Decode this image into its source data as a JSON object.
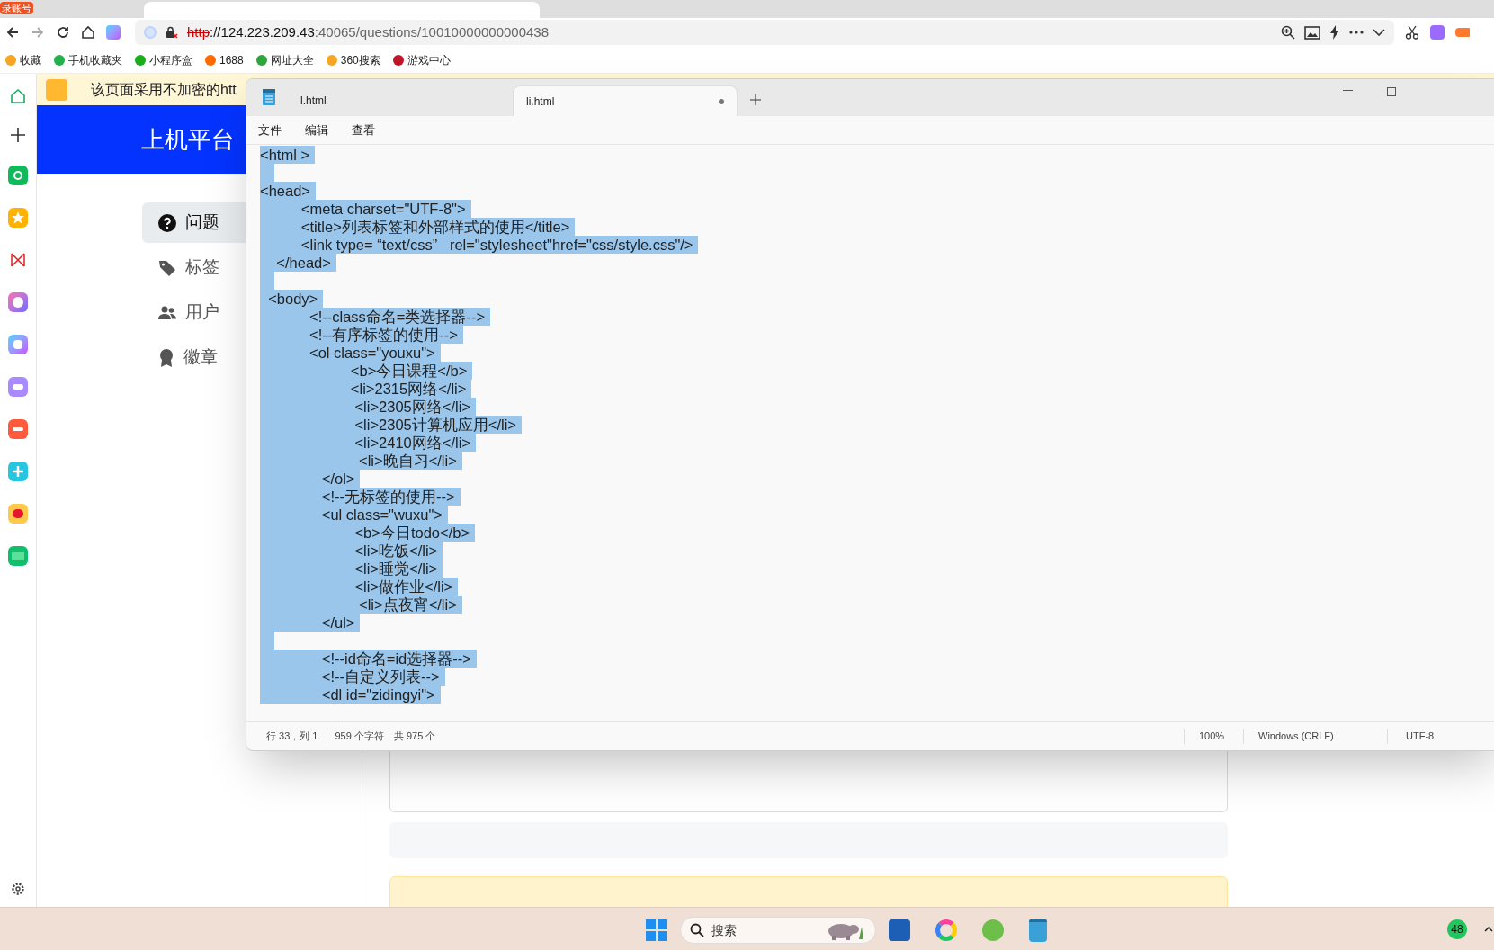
{
  "browser": {
    "badge": "录账号",
    "url_scheme": "http",
    "url_host": "://124.223.209.43",
    "url_rest": ":40065/questions/10010000000000438",
    "bookmarks": [
      {
        "label": "收藏",
        "color": "#f5a623"
      },
      {
        "label": "手机收藏夹",
        "color": "#22b14c"
      },
      {
        "label": "小程序盒",
        "color": "#1aad19"
      },
      {
        "label": "1688",
        "color": "#ff6a00"
      },
      {
        "label": "网址大全",
        "color": "#2fa43b"
      },
      {
        "label": "360搜索",
        "color": "#f5a623"
      },
      {
        "label": "游戏中心",
        "color": "#c0152a"
      }
    ]
  },
  "page": {
    "banner": "该页面采用不加密的htt",
    "brand": "上机平台",
    "nav": [
      {
        "label": "问题",
        "selected": true
      },
      {
        "label": "标签",
        "selected": false
      },
      {
        "label": "用户",
        "selected": false
      },
      {
        "label": "徽章",
        "selected": false
      }
    ]
  },
  "notepad": {
    "tabs": [
      {
        "label": "l.html",
        "selected": false,
        "modified": false
      },
      {
        "label": "li.html",
        "selected": true,
        "modified": true
      }
    ],
    "menu": [
      "文件",
      "编辑",
      "查看"
    ],
    "lines": [
      {
        "kind": "code",
        "text": "<html >",
        "selected": true
      },
      {
        "kind": "blank",
        "selected": true
      },
      {
        "kind": "code",
        "text": "<head>",
        "selected": true
      },
      {
        "kind": "code",
        "text": "\t<meta charset=\"UTF-8\">",
        "selected": true
      },
      {
        "kind": "code",
        "text": "\t<title>列表标签和外部样式的使用</title>",
        "selected": true
      },
      {
        "kind": "code",
        "text": "\t<link type= “text/css”   rel=\"stylesheet\"href=\"css/style.css\"/>",
        "selected": true
      },
      {
        "kind": "code",
        "text": "    </head>",
        "selected": true
      },
      {
        "kind": "blank",
        "selected": true
      },
      {
        "kind": "code",
        "text": "  <body>",
        "selected": true
      },
      {
        "kind": "code",
        "text": "\t  <!--class命名=类选择器-->",
        "selected": true
      },
      {
        "kind": "code",
        "text": "\t  <!--有序标签的使用-->",
        "selected": true
      },
      {
        "kind": "code",
        "text": "\t  <ol class=\"youxu\">",
        "selected": true
      },
      {
        "kind": "code",
        "text": "\t\t  <b>今日课程</b>",
        "selected": true
      },
      {
        "kind": "code",
        "text": "\t\t  <li>2315网络</li>",
        "selected": true
      },
      {
        "kind": "code",
        "text": "\t\t   <li>2305网络</li>",
        "selected": true
      },
      {
        "kind": "code",
        "text": "\t\t   <li>2305计算机应用</li>",
        "selected": true
      },
      {
        "kind": "code",
        "text": "\t\t   <li>2410网络</li>",
        "selected": true
      },
      {
        "kind": "code",
        "text": "\t\t    <li>晚自习</li>",
        "selected": true
      },
      {
        "kind": "code",
        "text": "\t     </ol>",
        "selected": true
      },
      {
        "kind": "code",
        "text": "\t     <!--无标签的使用-->",
        "selected": true
      },
      {
        "kind": "code",
        "text": "\t     <ul class=\"wuxu\">",
        "selected": true
      },
      {
        "kind": "code",
        "text": "\t\t   <b>今日todo</b>",
        "selected": true
      },
      {
        "kind": "code",
        "text": "\t\t   <li>吃饭</li>",
        "selected": true
      },
      {
        "kind": "code",
        "text": "\t\t   <li>睡觉</li>",
        "selected": true
      },
      {
        "kind": "code",
        "text": "\t\t   <li>做作业</li>",
        "selected": true
      },
      {
        "kind": "code",
        "text": "\t\t    <li>点夜宵</li>",
        "selected": true
      },
      {
        "kind": "code",
        "text": "\t     </ul>",
        "selected": true
      },
      {
        "kind": "blank",
        "selected": true
      },
      {
        "kind": "code",
        "text": "\t     <!--id命名=id选择器-->",
        "selected": true
      },
      {
        "kind": "code",
        "text": "\t     <!--自定义列表-->",
        "selected": true
      },
      {
        "kind": "code",
        "text": "\t     <dl id=\"zidingyi\">",
        "selected": true
      }
    ],
    "status": {
      "position": "行 33，列 1",
      "chars": "959 个字符，共 975 个",
      "zoom": "100%",
      "line_ending": "Windows (CRLF)",
      "encoding": "UTF-8"
    }
  },
  "taskbar": {
    "search_placeholder": "搜索",
    "tray_badge": "48"
  }
}
